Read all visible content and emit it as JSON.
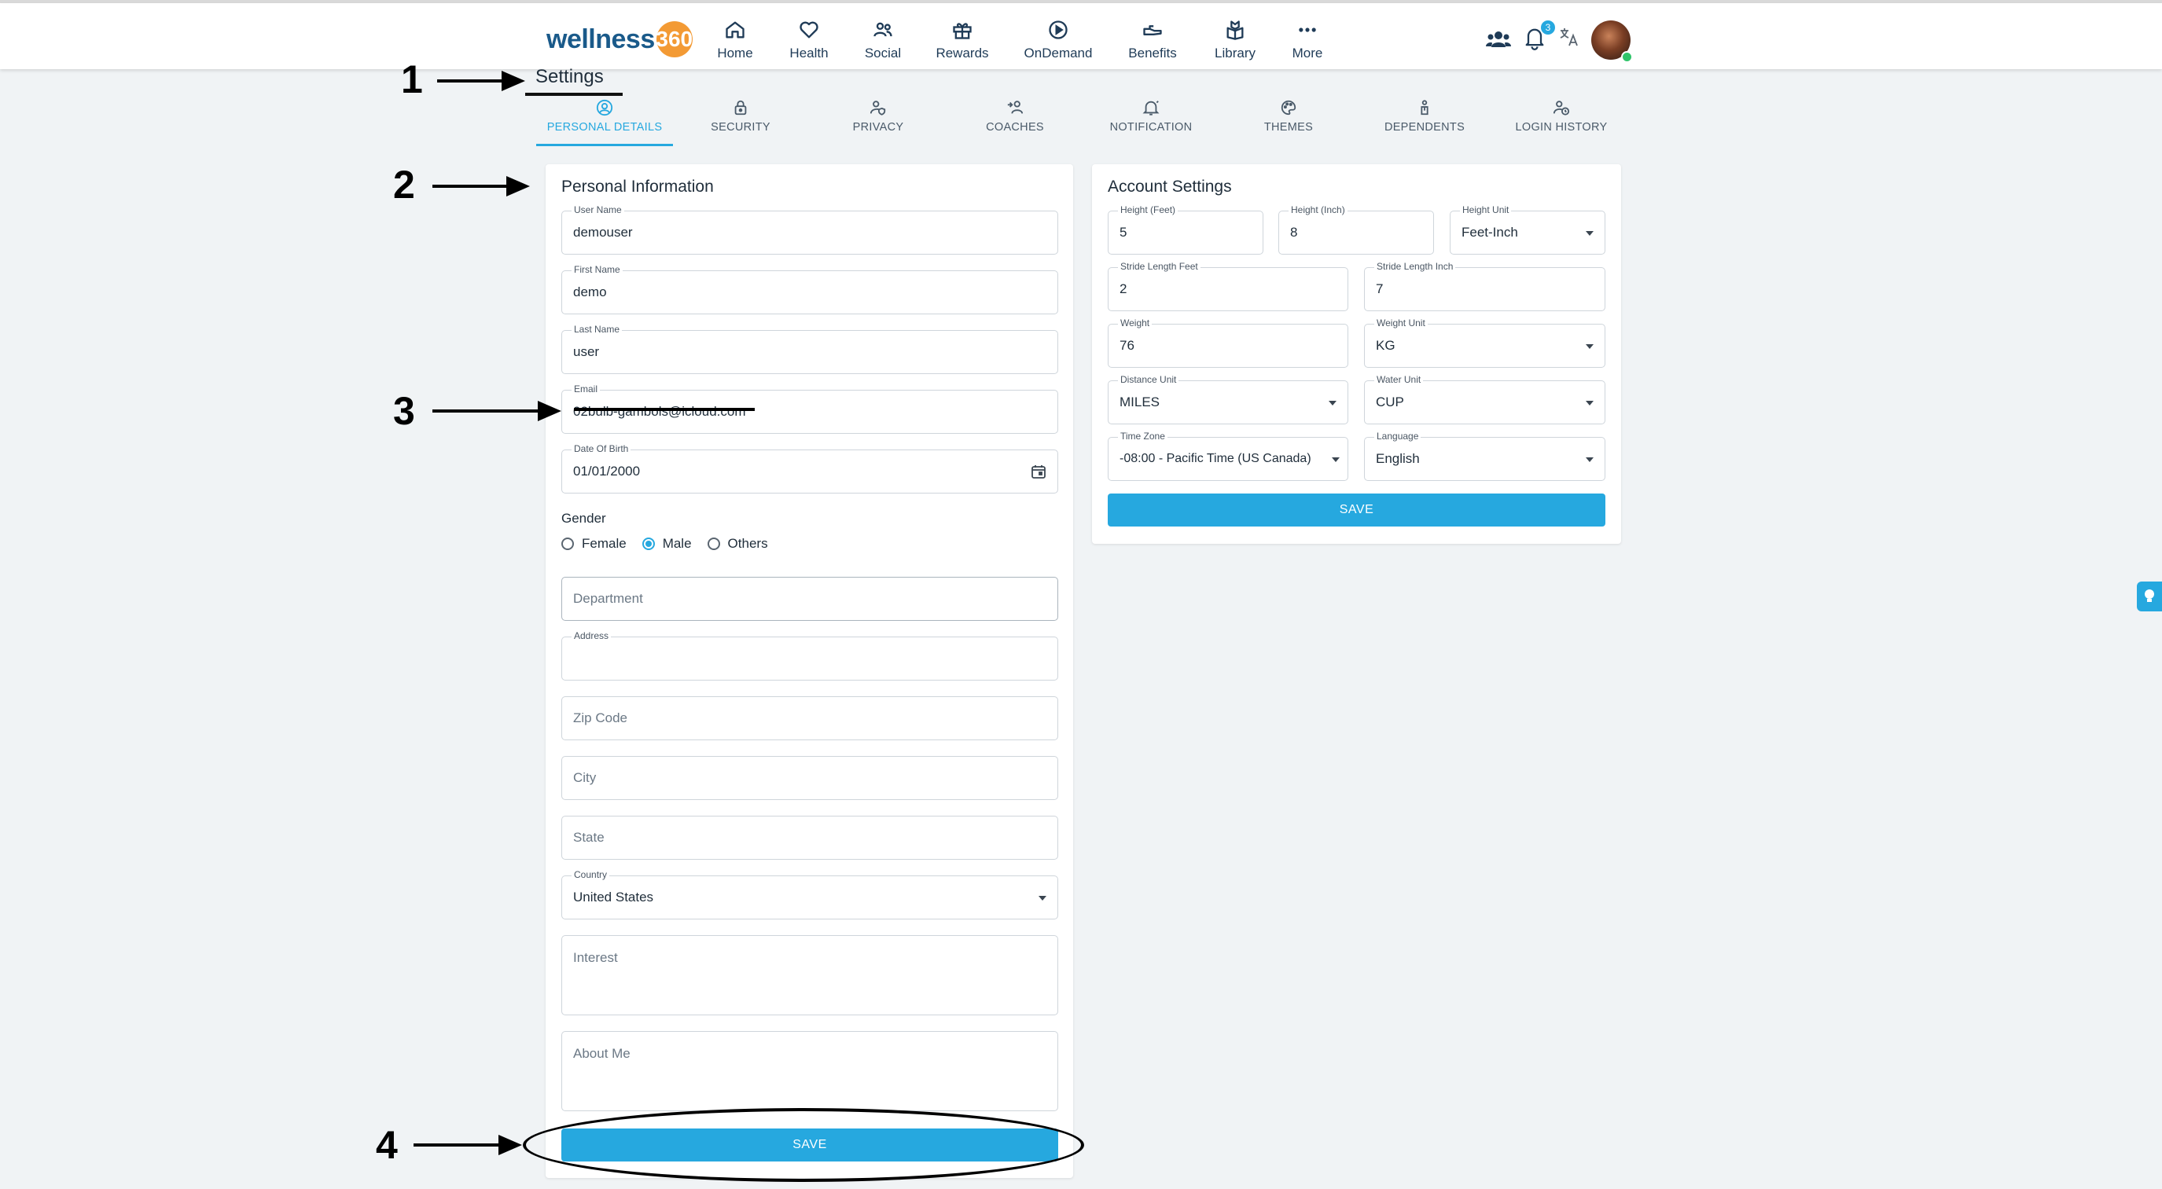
{
  "brand": {
    "name": "wellness",
    "badge": "360"
  },
  "nav": {
    "items": [
      {
        "label": "Home",
        "icon": "home-icon"
      },
      {
        "label": "Health",
        "icon": "heart-icon"
      },
      {
        "label": "Social",
        "icon": "people-icon"
      },
      {
        "label": "Rewards",
        "icon": "gift-icon"
      },
      {
        "label": "OnDemand",
        "icon": "play-circle-icon"
      },
      {
        "label": "Benefits",
        "icon": "hand-icon"
      },
      {
        "label": "Library",
        "icon": "book-icon"
      },
      {
        "label": "More",
        "icon": "more-dots-icon"
      }
    ],
    "notification_count": "3"
  },
  "page": {
    "title": "Settings"
  },
  "tabs": [
    {
      "label": "PERSONAL DETAILS",
      "active": true
    },
    {
      "label": "SECURITY"
    },
    {
      "label": "PRIVACY"
    },
    {
      "label": "COACHES"
    },
    {
      "label": "NOTIFICATION"
    },
    {
      "label": "THEMES"
    },
    {
      "label": "DEPENDENTS"
    },
    {
      "label": "LOGIN HISTORY"
    }
  ],
  "personal": {
    "title": "Personal Information",
    "username": {
      "label": "User Name",
      "value": "demouser"
    },
    "first_name": {
      "label": "First Name",
      "value": "demo"
    },
    "last_name": {
      "label": "Last Name",
      "value": "user"
    },
    "email": {
      "label": "Email",
      "value": "02bulb-gambols@icloud.com"
    },
    "dob": {
      "label": "Date Of Birth",
      "value": "01/01/2000"
    },
    "gender": {
      "label": "Gender",
      "options": [
        "Female",
        "Male",
        "Others"
      ],
      "selected": "Male"
    },
    "department": {
      "placeholder": "Department"
    },
    "address": {
      "label": "Address",
      "value": ""
    },
    "zip": {
      "placeholder": "Zip Code"
    },
    "city": {
      "placeholder": "City"
    },
    "state": {
      "placeholder": "State"
    },
    "country": {
      "label": "Country",
      "value": "United States"
    },
    "interest": {
      "placeholder": "Interest"
    },
    "about": {
      "placeholder": "About Me"
    },
    "save_label": "SAVE"
  },
  "account": {
    "title": "Account Settings",
    "height_feet": {
      "label": "Height (Feet)",
      "value": "5"
    },
    "height_inch": {
      "label": "Height (Inch)",
      "value": "8"
    },
    "height_unit": {
      "label": "Height Unit",
      "value": "Feet-Inch"
    },
    "stride_feet": {
      "label": "Stride Length Feet",
      "value": "2"
    },
    "stride_inch": {
      "label": "Stride Length Inch",
      "value": "7"
    },
    "weight": {
      "label": "Weight",
      "value": "76"
    },
    "weight_unit": {
      "label": "Weight Unit",
      "value": "KG"
    },
    "distance_unit": {
      "label": "Distance Unit",
      "value": "MILES"
    },
    "water_unit": {
      "label": "Water Unit",
      "value": "CUP"
    },
    "timezone": {
      "label": "Time Zone",
      "value": "-08:00 - Pacific Time (US Canada)"
    },
    "language": {
      "label": "Language",
      "value": "English"
    },
    "save_label": "SAVE"
  },
  "annotations": {
    "a1": "1",
    "a2": "2",
    "a3": "3",
    "a4": "4"
  },
  "colors": {
    "accent": "#26a8df",
    "brand_blue": "#1a5a8a",
    "brand_orange": "#f39a34",
    "background": "#f0f3f5"
  }
}
